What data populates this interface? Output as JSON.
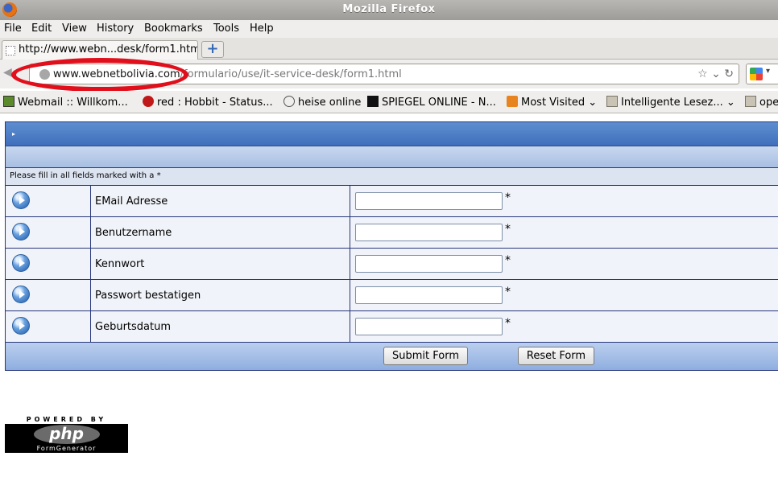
{
  "window": {
    "title": "Mozilla Firefox"
  },
  "menu": [
    "File",
    "Edit",
    "View",
    "History",
    "Bookmarks",
    "Tools",
    "Help"
  ],
  "tab": {
    "label": "http://www.webn...desk/form1.html",
    "new_tab_label": "+"
  },
  "urlbar": {
    "host": "www.webnetbolivia.com",
    "path": "/formulario/use/it-service-desk/form1.html"
  },
  "bookmarks": [
    {
      "label": "Webmail :: Willkom...",
      "icon": "webmail-icon"
    },
    {
      "label": "red : Hobbit - Status...",
      "icon": "red-status-icon"
    },
    {
      "label": "heise online",
      "icon": "heise-icon"
    },
    {
      "label": "SPIEGEL ONLINE - N...",
      "icon": "spiegel-icon"
    },
    {
      "label": "Most Visited",
      "icon": "rss-icon"
    },
    {
      "label": "Intelligente Lesez...",
      "icon": "folder-icon"
    },
    {
      "label": "ope",
      "icon": "folder-icon"
    }
  ],
  "form": {
    "header_glyph": "▸",
    "note": "Please fill in all fields marked with a *",
    "required_mark": "*",
    "fields": [
      {
        "label": "EMail Adresse",
        "value": ""
      },
      {
        "label": "Benutzername",
        "value": ""
      },
      {
        "label": "Kennwort",
        "value": ""
      },
      {
        "label": "Passwort bestatigen",
        "value": ""
      },
      {
        "label": "Geburtsdatum",
        "value": ""
      }
    ],
    "submit_label": "Submit Form",
    "reset_label": "Reset Form"
  },
  "badge": {
    "top": "POWERED BY",
    "main": "php",
    "sub": "FormGenerator"
  },
  "colors": {
    "highlight": "#e10f1b",
    "form_header": "#4a7cc4",
    "form_border": "#27377a"
  }
}
